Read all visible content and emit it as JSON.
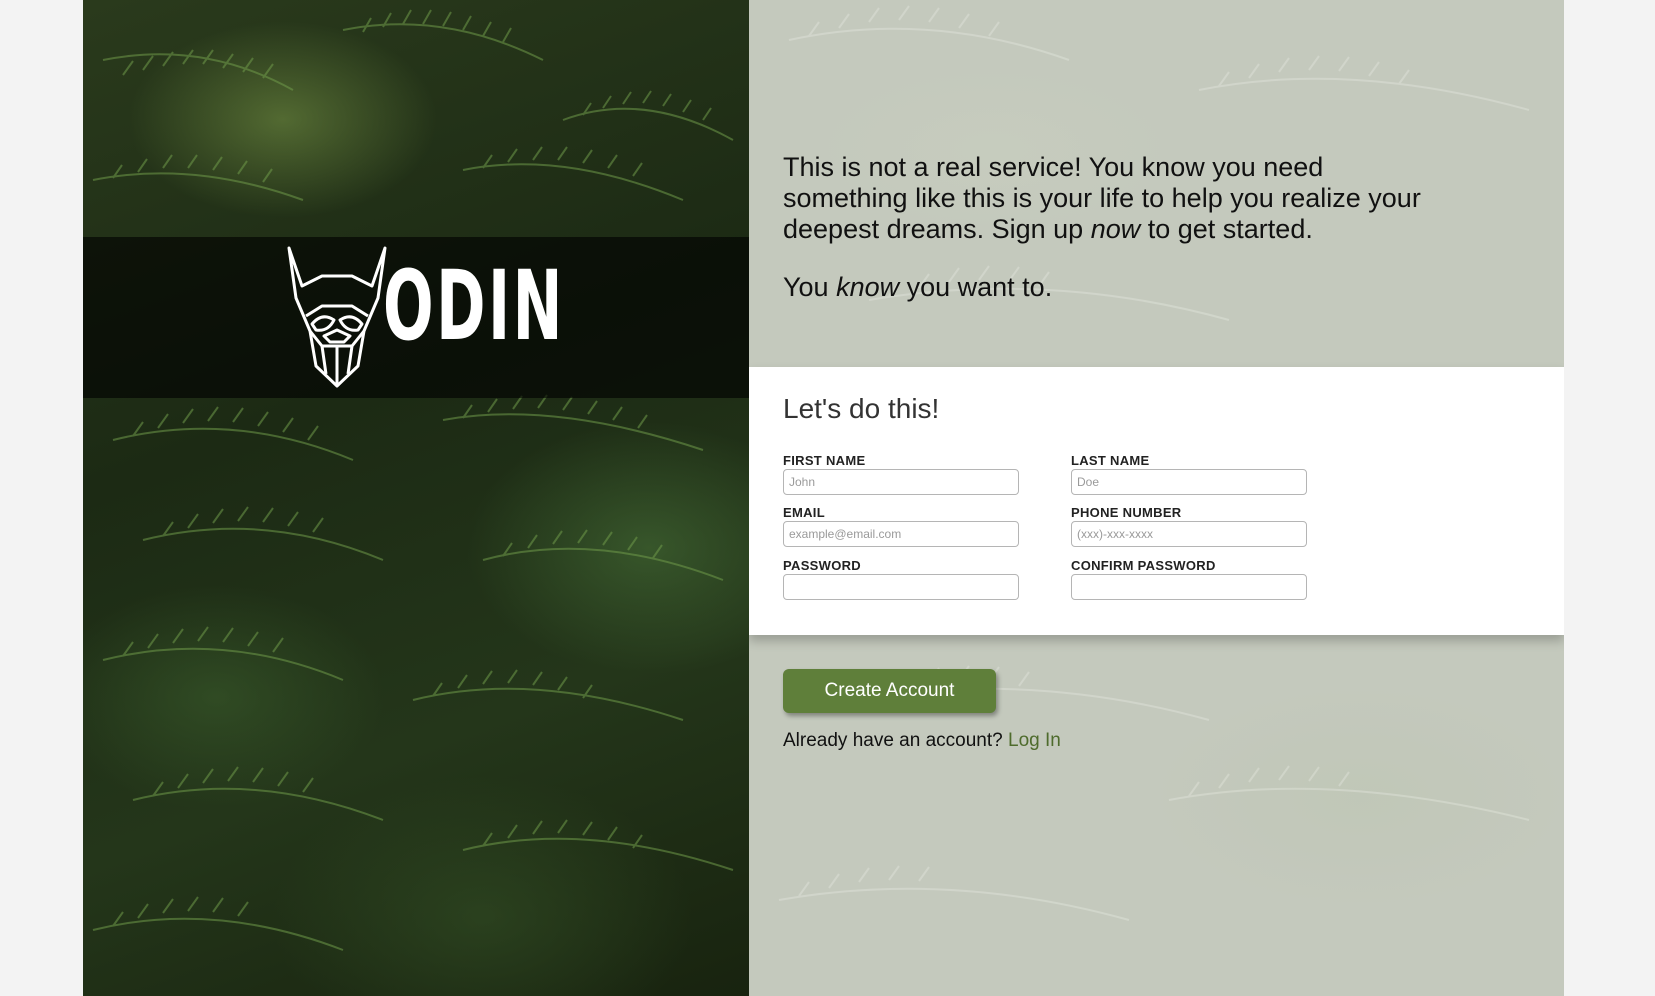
{
  "brand": {
    "logo_text": "ODIN",
    "logo_icon": "viking-helmet-icon"
  },
  "intro": {
    "line1_part1": "This is not a real service! You know you need something like this is your life to help you realize your deepest dreams. Sign up ",
    "line1_emphasis": "now",
    "line1_part2": " to get started.",
    "line2_part1": "You ",
    "line2_emphasis": "know",
    "line2_part2": " you want to."
  },
  "form": {
    "heading": "Let's do this!",
    "fields": {
      "first_name": {
        "label": "FIRST NAME",
        "placeholder": "John",
        "value": ""
      },
      "last_name": {
        "label": "LAST NAME",
        "placeholder": "Doe",
        "value": ""
      },
      "email": {
        "label": "EMAIL",
        "placeholder": "example@email.com",
        "value": ""
      },
      "phone": {
        "label": "PHONE NUMBER",
        "placeholder": "(xxx)-xxx-xxxx",
        "value": ""
      },
      "password": {
        "label": "PASSWORD",
        "placeholder": "",
        "value": ""
      },
      "confirm_password": {
        "label": "CONFIRM PASSWORD",
        "placeholder": "",
        "value": ""
      }
    }
  },
  "actions": {
    "create_label": "Create Account",
    "login_prompt": "Already have an account?",
    "login_link": "Log In"
  },
  "colors": {
    "accent": "#5f7f3a",
    "link": "#4e6b2c",
    "card": "#ffffff"
  }
}
